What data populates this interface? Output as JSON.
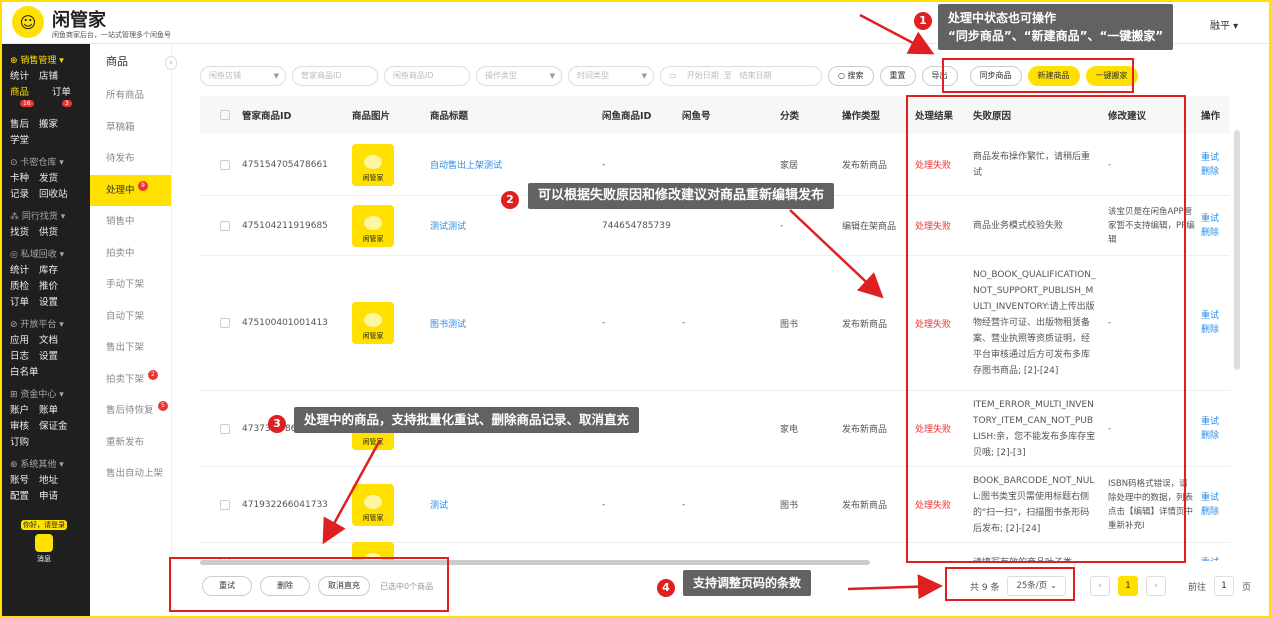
{
  "header": {
    "logo_char": "☺",
    "brand": "闲管家",
    "brand_sub": "闲鱼商家后台，一站式管理多个闲鱼号",
    "user": "融平 ▾"
  },
  "sidebar": [
    {
      "title": "⊕ 销售管理 ▾",
      "active": true,
      "rows": [
        [
          "统计",
          "店铺"
        ],
        [
          "商品",
          "订单"
        ],
        [
          "售后",
          "搬家"
        ],
        [
          "学堂"
        ]
      ],
      "badges": {
        "商品": "16",
        "订单": "3"
      }
    },
    {
      "title": "⊙ 卡密仓库 ▾",
      "rows": [
        [
          "卡种",
          "发货"
        ],
        [
          "记录",
          "回收站"
        ]
      ]
    },
    {
      "title": "⁂ 同行找货 ▾",
      "rows": [
        [
          "找货",
          "供货"
        ]
      ]
    },
    {
      "title": "◎ 私域回收 ▾",
      "rows": [
        [
          "统计",
          "库存"
        ],
        [
          "质检",
          "推价"
        ],
        [
          "订单",
          "设置"
        ]
      ]
    },
    {
      "title": "⊘ 开放平台 ▾",
      "rows": [
        [
          "应用",
          "文档"
        ],
        [
          "日志",
          "设置"
        ],
        [
          "白名单"
        ]
      ]
    },
    {
      "title": "⊞ 资金中心 ▾",
      "rows": [
        [
          "账户",
          "账单"
        ],
        [
          "审核",
          "保证金"
        ],
        [
          "订购"
        ]
      ]
    },
    {
      "title": "⊛ 系统其他 ▾",
      "rows": [
        [
          "账号",
          "地址"
        ],
        [
          "配置",
          "申请"
        ]
      ]
    }
  ],
  "sidebar_login": {
    "pill": "你好，请登录",
    "msg": "消息"
  },
  "subnav": {
    "head": "商品",
    "items": [
      {
        "label": "所有商品"
      },
      {
        "label": "草稿箱"
      },
      {
        "label": "待发布"
      },
      {
        "label": "处理中",
        "badge": "9",
        "active": true
      },
      {
        "label": "销售中"
      },
      {
        "label": "拍卖中"
      },
      {
        "label": "手动下架"
      },
      {
        "label": "自动下架"
      },
      {
        "label": "售出下架"
      },
      {
        "label": "拍卖下架",
        "badge": "2"
      },
      {
        "label": "售后待恢复",
        "badge": "5"
      },
      {
        "label": "重新发布"
      },
      {
        "label": "售出自动上架"
      }
    ]
  },
  "filters": {
    "store": "闲鱼店铺",
    "mgr_id": "管家商品ID",
    "xy_id": "闲鱼商品ID",
    "op_type": "操作类型",
    "time_type": "时间类型",
    "start": "开始日期",
    "to": "至",
    "end": "结束日期",
    "search": "○ 搜索",
    "reset": "重置",
    "export": "导出",
    "sync": "同步商品",
    "new": "新建商品",
    "move": "一键搬家"
  },
  "table": {
    "columns": [
      "管家商品ID",
      "商品图片",
      "商品标题",
      "闲鱼商品ID",
      "闲鱼号",
      "分类",
      "操作类型",
      "处理结果",
      "失败原因",
      "修改建议",
      "操作"
    ],
    "thumb_label": "闲管家",
    "rows": [
      {
        "id": "475154705478661",
        "title": "自动售出上架测试",
        "xyid": "-",
        "xyh": "",
        "cat": "家居",
        "op": "发布新商品",
        "result": "处理失败",
        "reason": "商品发布操作繁忙，请稍后重试",
        "suggest": "-",
        "retry": "重试",
        "del": "删除"
      },
      {
        "id": "475104211919685",
        "title": "测试测试",
        "xyid": "744654785739",
        "xyh": "",
        "cat": "-",
        "op": "编辑在架商品",
        "result": "处理失败",
        "reason": "商品业务模式校验失败",
        "suggest": "该宝贝是在闲鱼APP管家暂不支持编辑，PP编辑",
        "retry": "重试",
        "del": "删除"
      },
      {
        "id": "475100401001413",
        "title": "图书测试",
        "xyid": "-",
        "xyh": "-",
        "cat": "图书",
        "op": "发布新商品",
        "result": "处理失败",
        "reason": "NO_BOOK_QUALIFICATION_NOT_SUPPORT_PUBLISH_MULTI_INVENTORY:请上传出版物经营许可证、出版物租赁备案、营业执照等资质证明，经平台审核通过后方可发布多库存图书商品; [2]-[24]",
        "suggest": "-",
        "retry": "重试",
        "del": "删除"
      },
      {
        "id": "47373...9860",
        "title": "",
        "xyid": "",
        "xyh": "",
        "cat": "家电",
        "op": "发布新商品",
        "result": "处理失败",
        "reason": "ITEM_ERROR_MULTI_INVENTORY_ITEM_CAN_NOT_PUBLISH:亲，您不能发布多库存宝贝哦; [2]-[3]",
        "suggest": "-",
        "retry": "重试",
        "del": "删除"
      },
      {
        "id": "471932266041733",
        "title": "测试",
        "xyid": "-",
        "xyh": "-",
        "cat": "图书",
        "op": "发布新商品",
        "result": "处理失败",
        "reason": "BOOK_BARCODE_NOT_NULL:图书类宝贝需使用标题右侧的\"扫一扫\"，扫描图书条形码后发布; [2]-[24]",
        "suggest": "ISBN码格式错误，请除处理中的数据，列表点击【编辑】详情页中重新补充I",
        "retry": "重试",
        "del": "删除"
      },
      {
        "id": "",
        "title": "",
        "xyid": "",
        "xyh": "",
        "cat": "",
        "op": "",
        "result": "",
        "reason": "请填写有效的商品叶子类",
        "suggest": "",
        "retry": "重试",
        "del": ""
      }
    ]
  },
  "bottom": {
    "retry": "重试",
    "delete": "删除",
    "cancel": "取消直充",
    "selected": "已选中0个商品"
  },
  "pager": {
    "total": "共 9 条",
    "size": "25条/页",
    "page": "1",
    "goto": "前往",
    "goto_val": "1",
    "page_unit": "页"
  },
  "callouts": [
    {
      "n": "1",
      "text": "处理中状态也可操作\n“同步商品”、“新建商品”、“一键搬家”"
    },
    {
      "n": "2",
      "text": "可以根据失败原因和修改建议对商品重新编辑发布"
    },
    {
      "n": "3",
      "text": "处理中的商品，支持批量化重试、删除商品记录、取消直充"
    },
    {
      "n": "4",
      "text": "支持调整页码的条数"
    }
  ]
}
